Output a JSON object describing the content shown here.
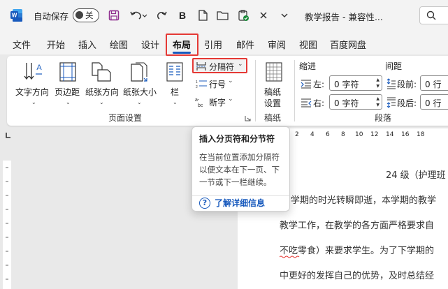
{
  "titlebar": {
    "autosave_label": "自动保存",
    "autosave_state": "关",
    "doc_title": "教学报告 - 兼容性..."
  },
  "tabs": [
    "文件",
    "开始",
    "插入",
    "绘图",
    "设计",
    "布局",
    "引用",
    "邮件",
    "审阅",
    "视图",
    "百度网盘"
  ],
  "active_tab": "布局",
  "ribbon": {
    "page_setup": {
      "buttons": [
        "文字方向",
        "页边距",
        "纸张方向",
        "纸张大小",
        "栏"
      ],
      "breaks": "分隔符",
      "line_numbers": "行号",
      "hyphenation": "断字",
      "group_label": "页面设置"
    },
    "draft": {
      "button": "稿纸设置",
      "button_line1": "稿纸",
      "button_line2": "设置",
      "group_label": "稿纸"
    },
    "paragraph": {
      "indent_label": "缩进",
      "spacing_label": "间距",
      "left_label": "左:",
      "right_label": "右:",
      "left_value": "0 字符",
      "right_value": "0 字符",
      "before_label": "段前:",
      "after_label": "段后:",
      "before_value": "0 行",
      "after_value": "0 行",
      "group_label": "段落"
    }
  },
  "ruler": {
    "marks": [
      "2",
      "4",
      "6",
      "8",
      "10",
      "12",
      "14",
      "16",
      "18"
    ]
  },
  "document": {
    "line1": "24 级（护理班",
    "line2": "学期的时光转瞬即逝，本学期的教学",
    "line3": "教学工作，在教学的各方面严格要求自",
    "line4": "不吃零食）来要求学生。为了下学期的",
    "line5": "中更好的发挥自己的优势，及时总结经"
  },
  "tooltip": {
    "title": "插入分页符和分节符",
    "body": "在当前位置添加分隔符以便文本在下一页、下一节或下一栏继续。",
    "link": "了解详细信息"
  },
  "colors": {
    "accent": "#185abd",
    "highlight_border": "#e53935",
    "word_blue": "#185abd"
  }
}
